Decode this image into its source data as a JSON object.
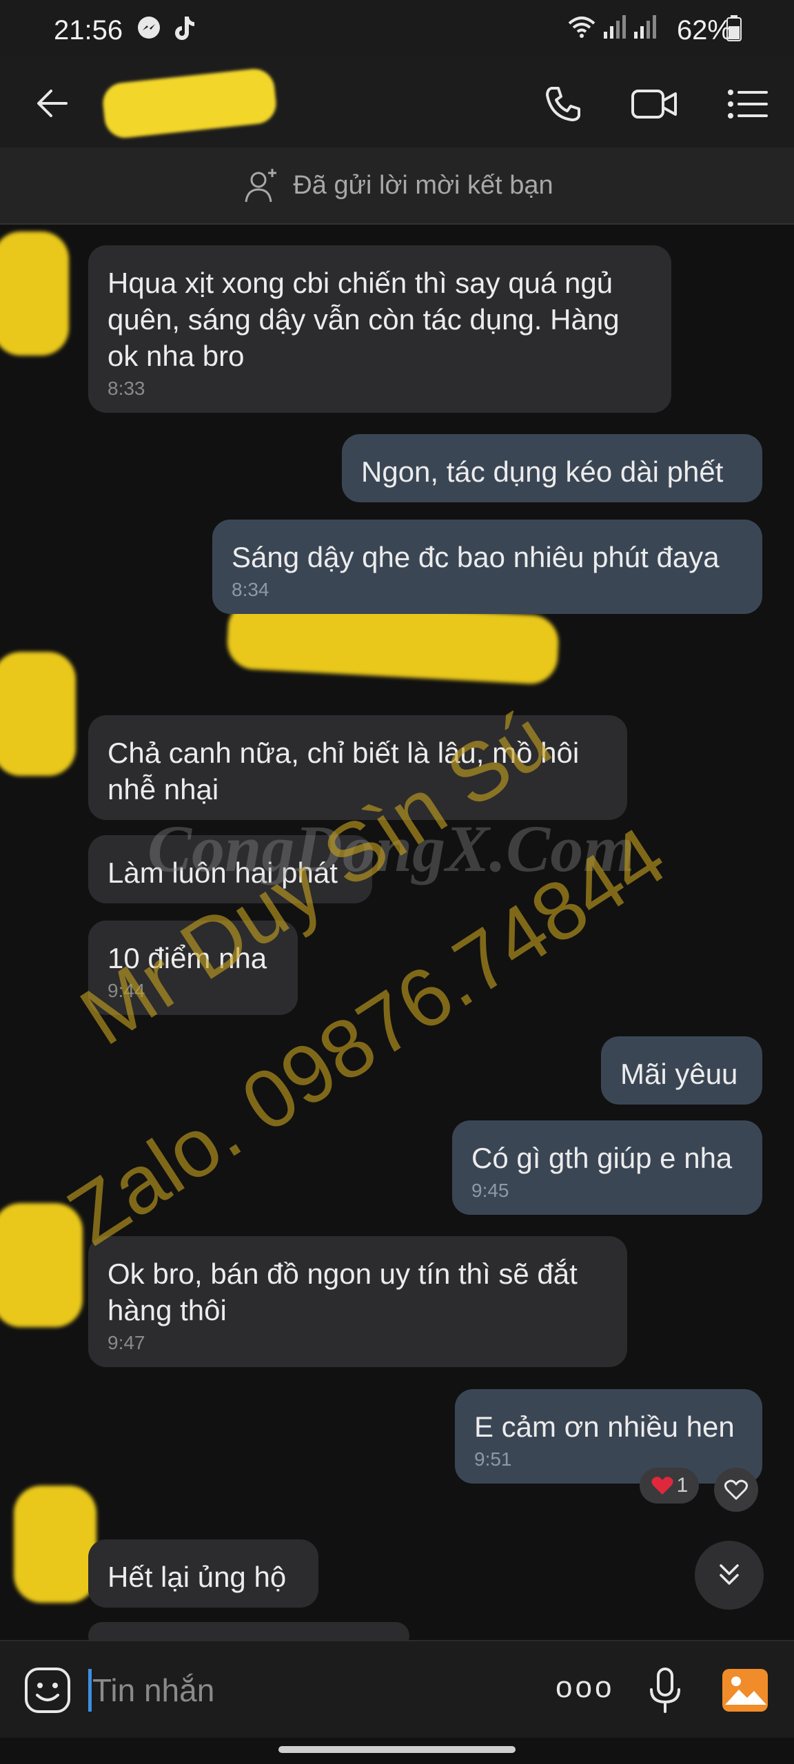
{
  "status_bar": {
    "time": "21:56",
    "battery": "62%"
  },
  "header": {
    "contact_name": ""
  },
  "friend_request": {
    "text": "Đã gửi lời mời kết bạn"
  },
  "messages": [
    {
      "dir": "in",
      "text": "Hqua xịt xong cbi chiến thì say quá ngủ quên, sáng dậy vẫn còn tác dụng. Hàng ok nha bro",
      "time": "8:33"
    },
    {
      "dir": "out",
      "text": "Ngon, tác dụng kéo dài phết",
      "time": ""
    },
    {
      "dir": "out",
      "text": "Sáng dậy qhe đc bao nhiêu phút đaya",
      "time": "8:34"
    },
    {
      "dir": "in",
      "text": "Chả canh nữa, chỉ biết là lâu, mồ hôi nhễ nhại",
      "time": ""
    },
    {
      "dir": "in",
      "text": "Làm luôn hai phát",
      "time": ""
    },
    {
      "dir": "in",
      "text": "10 điểm nha",
      "time": "9:44"
    },
    {
      "dir": "out",
      "text": "Mãi yêuu",
      "time": ""
    },
    {
      "dir": "out",
      "text": "Có gì gth giúp e nha",
      "time": "9:45"
    },
    {
      "dir": "in",
      "text": "Ok bro, bán đồ ngon uy tín thì sẽ đắt hàng thôi",
      "time": "9:47"
    },
    {
      "dir": "out",
      "text": "E cảm ơn nhiều hen",
      "time": "9:51"
    },
    {
      "dir": "in",
      "text": "Hết lại ủng hộ",
      "time": ""
    }
  ],
  "reaction": {
    "count": "1"
  },
  "watermark": {
    "line1": "Mr Duy Sìn Sú",
    "line2": "Zalo. 09876.74844",
    "site": "CongDongX.Com"
  },
  "input": {
    "placeholder": "Tin nhắn",
    "more": "ooo"
  },
  "colors": {
    "bg": "#111111",
    "bubble_in": "#2c2c2e",
    "bubble_out": "#3b4655",
    "accent": "#3d8fe0",
    "image_icon": "#f08c2a"
  }
}
